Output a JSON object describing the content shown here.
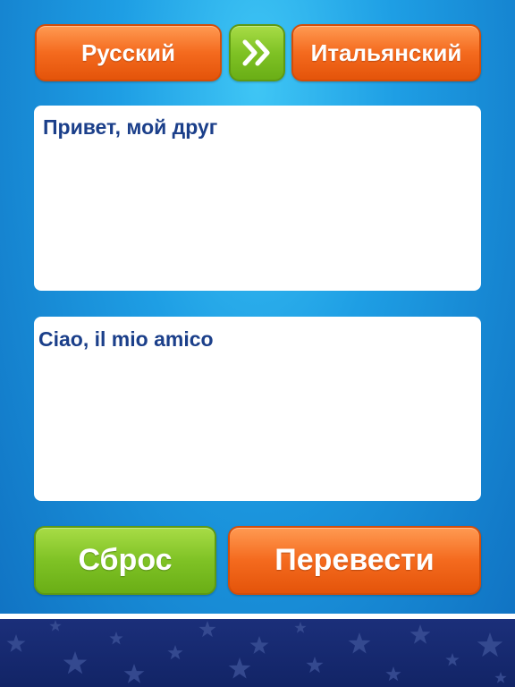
{
  "languages": {
    "source": "Русский",
    "target": "Итальянский",
    "swap_icon": "double-chevron-right-icon"
  },
  "input": {
    "text": "Привет, мой друг"
  },
  "output": {
    "text": "Ciao, il mio amico"
  },
  "actions": {
    "reset_label": "Сброс",
    "translate_label": "Перевести"
  },
  "colors": {
    "orange_button": "#f46a1e",
    "green_button": "#7fc225",
    "text": "#1b3f8a",
    "background": "#1e9ee4",
    "footer": "#1b2f7a"
  }
}
